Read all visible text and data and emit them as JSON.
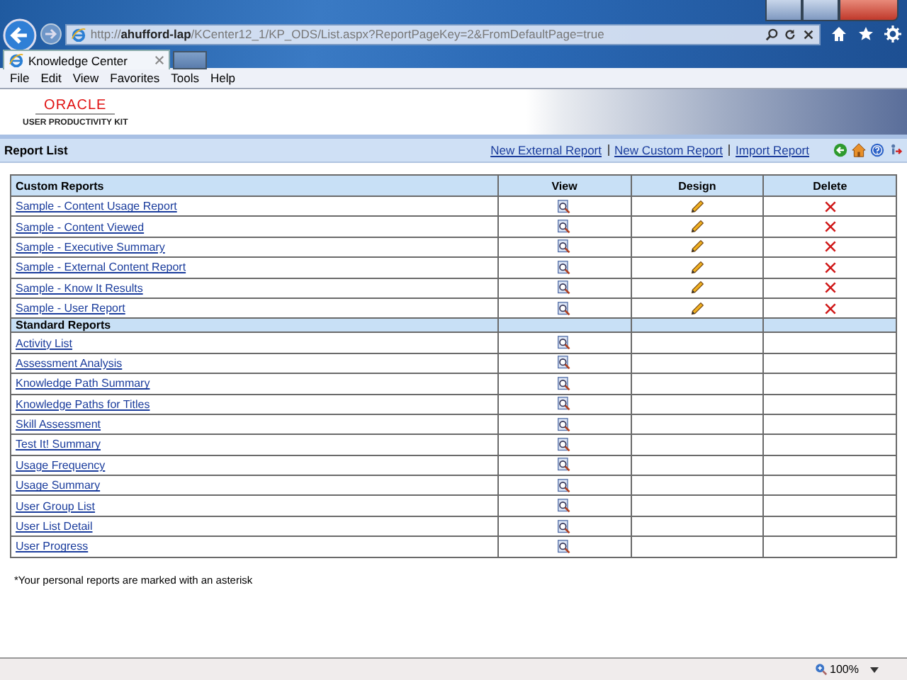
{
  "browser": {
    "address": "http://**ahufford-lap**/KCenter12_1/KP_ODS/List.aspx?ReportPageKey=2&FromDefaultPage=true",
    "tab_title": "Knowledge Center",
    "menu": [
      "File",
      "Edit",
      "View",
      "Favorites",
      "Tools",
      "Help"
    ],
    "zoom": "100%"
  },
  "logo": {
    "brand": "ORACLE",
    "product": "USER PRODUCTIVITY KIT"
  },
  "report_bar": {
    "title": "Report List",
    "links": [
      "New External Report",
      "New Custom Report",
      "Import Report"
    ]
  },
  "table": {
    "columns": [
      "Custom Reports",
      "View",
      "Design",
      "Delete"
    ],
    "groups": [
      {
        "kind": "custom",
        "rows": [
          "Sample - Content Usage Report",
          "Sample - Content Viewed",
          "Sample - Executive Summary",
          "Sample - External Content Report",
          "Sample - Know It Results",
          "Sample - User Report"
        ]
      },
      {
        "kind": "standard",
        "title": "Standard Reports",
        "rows": [
          "Activity List",
          "Assessment Analysis",
          "Knowledge Path Summary",
          "Knowledge Paths for Titles",
          "Skill Assessment",
          "Test It! Summary",
          "Usage Frequency",
          "Usage Summary",
          "User Group List",
          "User List Detail",
          "User Progress"
        ]
      }
    ]
  },
  "footnote": "*Your personal reports are marked with an asterisk"
}
